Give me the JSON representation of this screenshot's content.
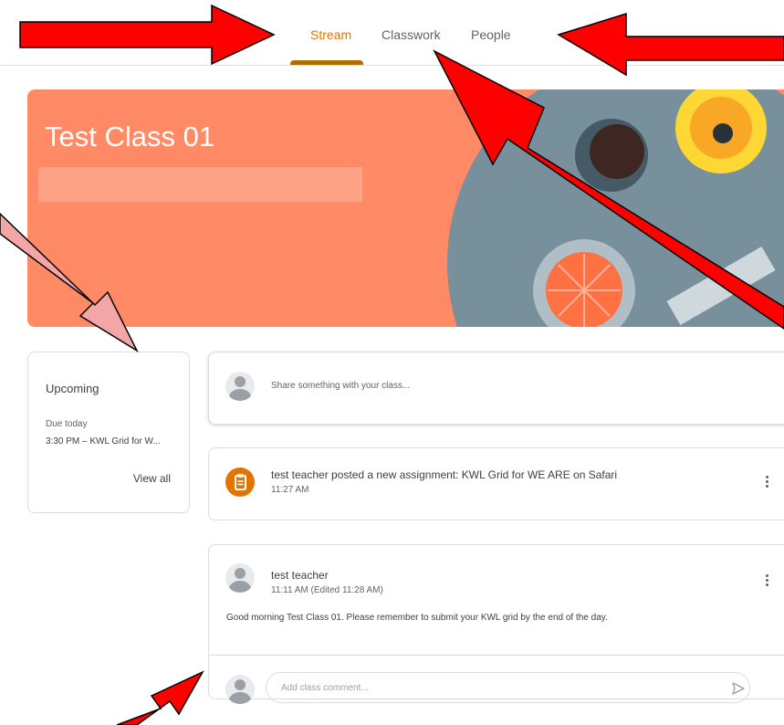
{
  "tabs": [
    {
      "label": "Stream",
      "active": true
    },
    {
      "label": "Classwork",
      "active": false
    },
    {
      "label": "People",
      "active": false
    }
  ],
  "banner": {
    "title": "Test Class 01",
    "color": "#ff8a65"
  },
  "upcoming": {
    "title": "Upcoming",
    "due": "Due today",
    "item": "3:30 PM – KWL Grid for W...",
    "view_all": "View all"
  },
  "share": {
    "placeholder": "Share something with your class..."
  },
  "assignment": {
    "icon": "assignment-icon",
    "title": "test teacher posted a new assignment: KWL Grid for WE ARE on Safari",
    "time": "11:27 AM"
  },
  "post": {
    "author": "test teacher",
    "time": "11:11 AM (Edited 11:28 AM)",
    "text": "Good morning Test Class 01. Please remember to submit your KWL grid by the end of the day.",
    "comment_placeholder": "Add class comment..."
  },
  "colors": {
    "accent": "#e37400",
    "annotation_arrow": "#ff0000",
    "annotation_arrow_light": "#f4a6a6"
  }
}
